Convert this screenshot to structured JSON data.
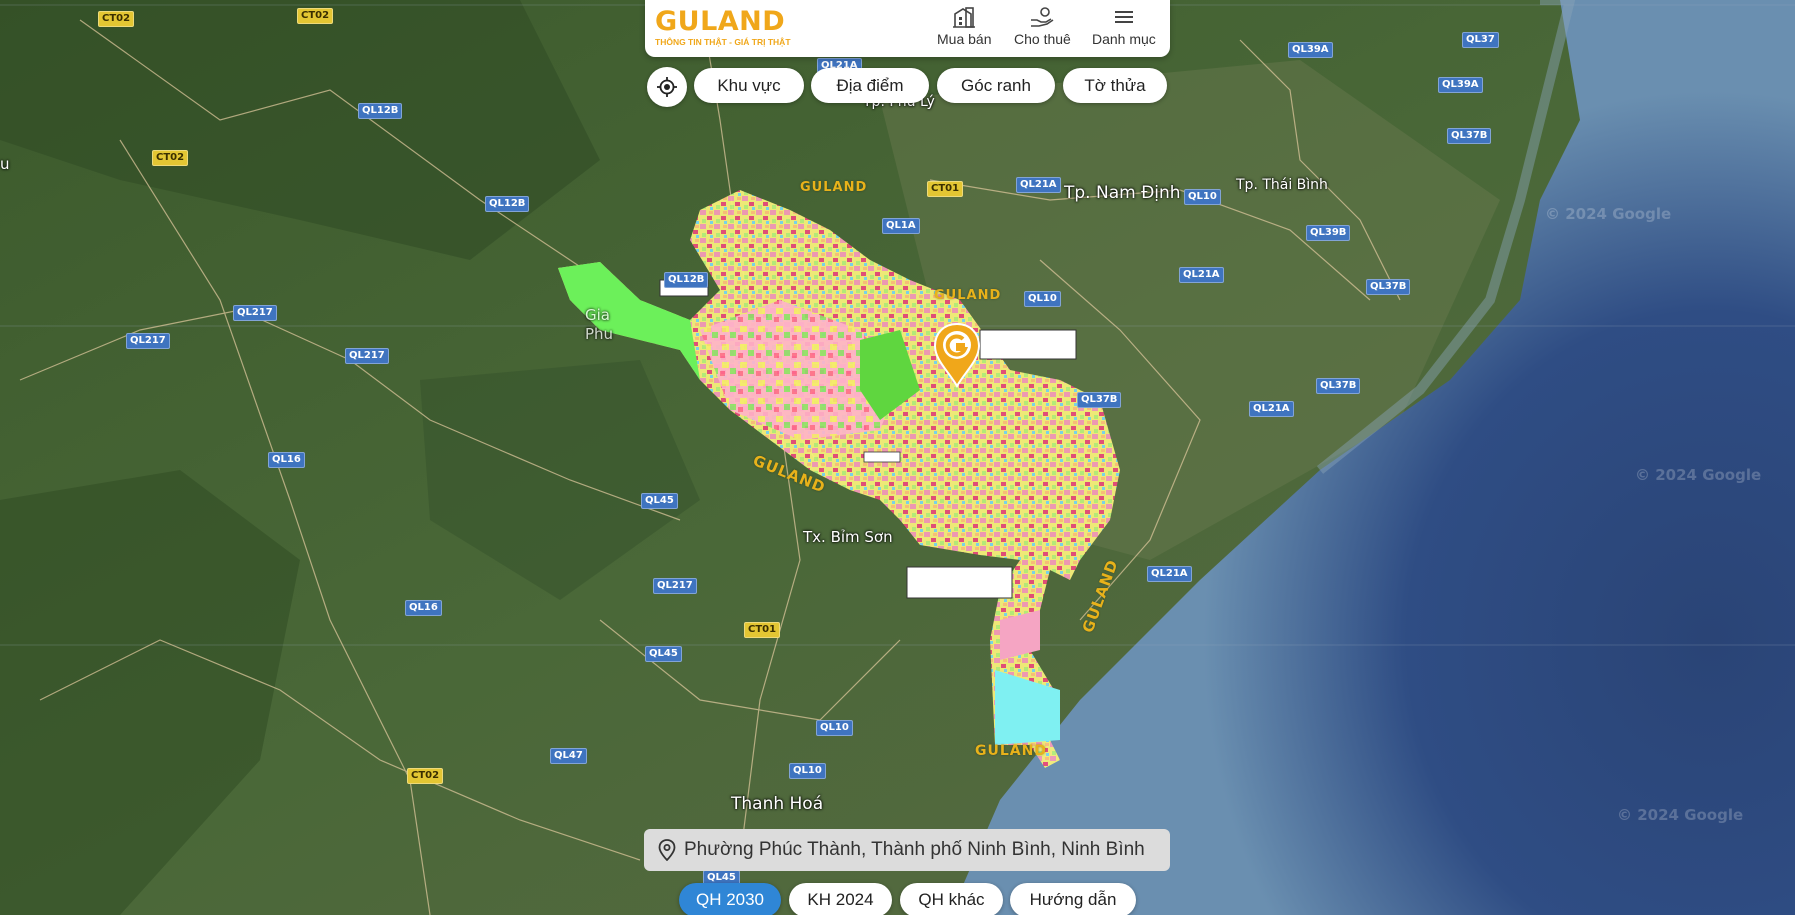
{
  "header": {
    "logo_text": "GULAND",
    "logo_tagline": "THÔNG TIN THẬT - GIÁ TRỊ THẬT",
    "nav": [
      {
        "label": "Mua bán",
        "icon": "building-icon"
      },
      {
        "label": "Cho thuê",
        "icon": "hand-key-icon"
      },
      {
        "label": "Danh mục",
        "icon": "menu-icon"
      }
    ]
  },
  "filters": {
    "locate_icon": "crosshair-icon",
    "chips": [
      "Khu vực",
      "Địa điểm",
      "Góc ranh",
      "Tờ thửa"
    ]
  },
  "map": {
    "cities": [
      "Tp. Nam Định",
      "Tp. Thái Bình",
      "Tp. Phủ Lý",
      "Tx. Bỉm Sơn",
      "Thanh Hoá",
      "Gia",
      "Phu",
      "u"
    ],
    "roads": [
      "CT02",
      "QL12B",
      "QL217",
      "QL16",
      "QL45",
      "CT01",
      "QL21A",
      "QL1A",
      "QL10",
      "QL39A",
      "QL37",
      "QL37B",
      "QL39B",
      "QL47"
    ],
    "watermarks": [
      "© 2024 Google"
    ],
    "overlay_brand": "GULAND"
  },
  "address": {
    "icon": "location-pin-icon",
    "text": "Phường Phúc Thành, Thành phố Ninh Bình, Ninh Bình"
  },
  "tabs": [
    {
      "label": "QH 2030",
      "active": true
    },
    {
      "label": "KH 2024",
      "active": false
    },
    {
      "label": "QH khác",
      "active": false
    },
    {
      "label": "Hướng dẫn",
      "active": false
    }
  ],
  "colors": {
    "brand": "#f0a71a",
    "active_tab": "#2f86d6"
  }
}
